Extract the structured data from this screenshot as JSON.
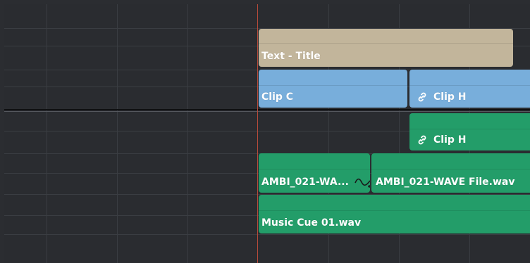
{
  "timeline": {
    "title_track": {
      "clips": [
        {
          "label": "Text - Title",
          "color": "#c2b59b"
        }
      ]
    },
    "video_track_1": {
      "clips": [
        {
          "label": "Clip C",
          "color": "#78aedb",
          "icon": null
        },
        {
          "label": "Clip H",
          "color": "#78aedb",
          "icon": "link-icon"
        }
      ]
    },
    "video_track_2": {
      "clips": [
        {
          "label": "Clip H",
          "color": "#239d69",
          "icon": "link-icon"
        }
      ]
    },
    "audio_track_1": {
      "clips": [
        {
          "label": "AMBI_021-WA...",
          "color": "#239d69",
          "icon": "crossfade-icon"
        },
        {
          "label": "AMBI_021-WAVE File.wav",
          "color": "#239d69"
        }
      ]
    },
    "audio_track_2": {
      "clips": [
        {
          "label": "Music Cue 01.wav",
          "color": "#239d69"
        }
      ]
    },
    "colors": {
      "background": "#2a2c30",
      "playhead": "#b84a3a",
      "title_clip": "#c2b59b",
      "video_clip": "#78aedb",
      "audio_clip": "#239d69"
    }
  }
}
